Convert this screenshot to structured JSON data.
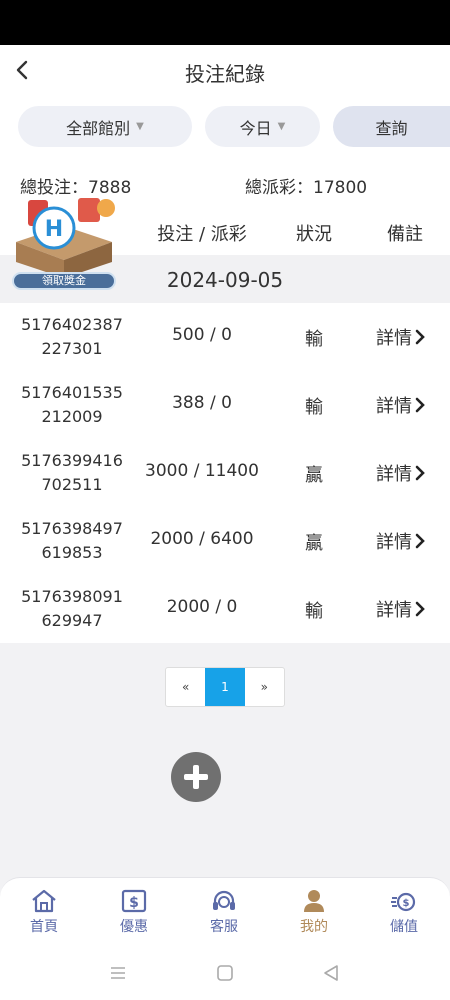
{
  "header": {
    "title": "投注紀錄",
    "back_icon": "chevron-left-icon"
  },
  "filters": {
    "venue_label": "全部館別",
    "date_label": "今日",
    "query_label": "查詢"
  },
  "totals": {
    "bet_label": "總投注：7888",
    "payout_label": "總派彩：17800"
  },
  "columns": {
    "amount": "投注 / 派彩",
    "status": "狀況",
    "remark": "備註"
  },
  "promo": {
    "label": "領取獎金"
  },
  "date_group": "2024-09-05",
  "rows": [
    {
      "id_line1": "5176402387",
      "id_line2": "227301",
      "amount": "500 / 0",
      "status": "輸",
      "detail": "詳情"
    },
    {
      "id_line1": "5176401535",
      "id_line2": "212009",
      "amount": "388 / 0",
      "status": "輸",
      "detail": "詳情"
    },
    {
      "id_line1": "5176399416",
      "id_line2": "702511",
      "amount": "3000 / 11400",
      "status": "贏",
      "detail": "詳情"
    },
    {
      "id_line1": "5176398497",
      "id_line2": "619853",
      "amount": "2000 / 6400",
      "status": "贏",
      "detail": "詳情"
    },
    {
      "id_line1": "5176398091",
      "id_line2": "629947",
      "amount": "2000 / 0",
      "status": "輸",
      "detail": "詳情"
    }
  ],
  "pagination": {
    "prev": "«",
    "current": "1",
    "next": "»"
  },
  "tabbar": {
    "items": [
      {
        "label": "首頁",
        "icon": "home-icon"
      },
      {
        "label": "優惠",
        "icon": "coupon-icon"
      },
      {
        "label": "客服",
        "icon": "headset-icon"
      },
      {
        "label": "我的",
        "icon": "user-icon",
        "active": true
      },
      {
        "label": "儲值",
        "icon": "deposit-icon"
      }
    ]
  },
  "colors": {
    "accent": "#17a2e8",
    "tab": "#5b6aa8",
    "tab_active": "#b08a5a"
  }
}
